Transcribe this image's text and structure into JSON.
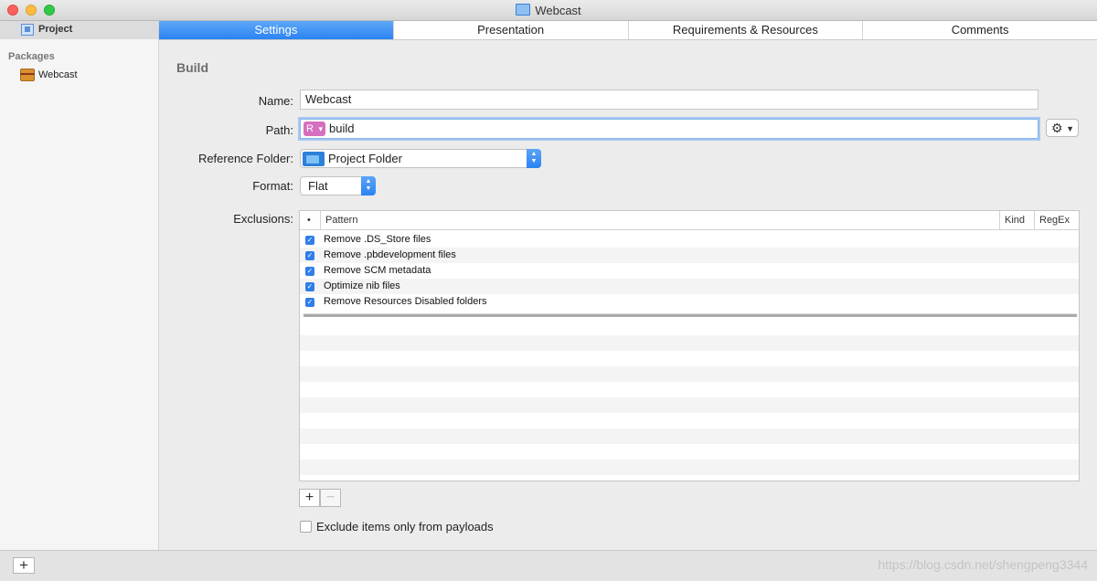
{
  "window": {
    "title": "Webcast"
  },
  "sidebar": {
    "project_label": "Project",
    "section_label": "Packages",
    "packages": [
      {
        "label": "Webcast"
      }
    ]
  },
  "tabs": [
    {
      "label": "Settings",
      "active": true
    },
    {
      "label": "Presentation",
      "active": false
    },
    {
      "label": "Requirements & Resources",
      "active": false
    },
    {
      "label": "Comments",
      "active": false
    }
  ],
  "build": {
    "section_title": "Build",
    "name_label": "Name:",
    "name_value": "Webcast",
    "path_label": "Path:",
    "path_badge": "R",
    "path_value": "build",
    "reference_label": "Reference Folder:",
    "reference_value": "Project Folder",
    "format_label": "Format:",
    "format_value": "Flat",
    "exclusions_label": "Exclusions:"
  },
  "exclusions_table": {
    "columns": {
      "bullet": "•",
      "pattern": "Pattern",
      "kind": "Kind",
      "regex": "RegEx"
    },
    "rows": [
      {
        "checked": true,
        "pattern": "Remove .DS_Store files"
      },
      {
        "checked": true,
        "pattern": "Remove .pbdevelopment files"
      },
      {
        "checked": true,
        "pattern": "Remove SCM metadata"
      },
      {
        "checked": true,
        "pattern": "Optimize nib files"
      },
      {
        "checked": true,
        "pattern": "Remove Resources Disabled folders"
      }
    ]
  },
  "buttons": {
    "add": "+",
    "remove": "−",
    "sidebar_add": "+"
  },
  "exclude_payloads": {
    "label": "Exclude items only from payloads",
    "checked": false
  },
  "icons": {
    "gear": "gear-icon",
    "folder": "folder-icon",
    "package": "package-icon"
  },
  "colors": {
    "accent": "#2a83f2",
    "path_badge": "#d56fbf"
  },
  "watermark": "https://blog.csdn.net/shengpeng3344"
}
